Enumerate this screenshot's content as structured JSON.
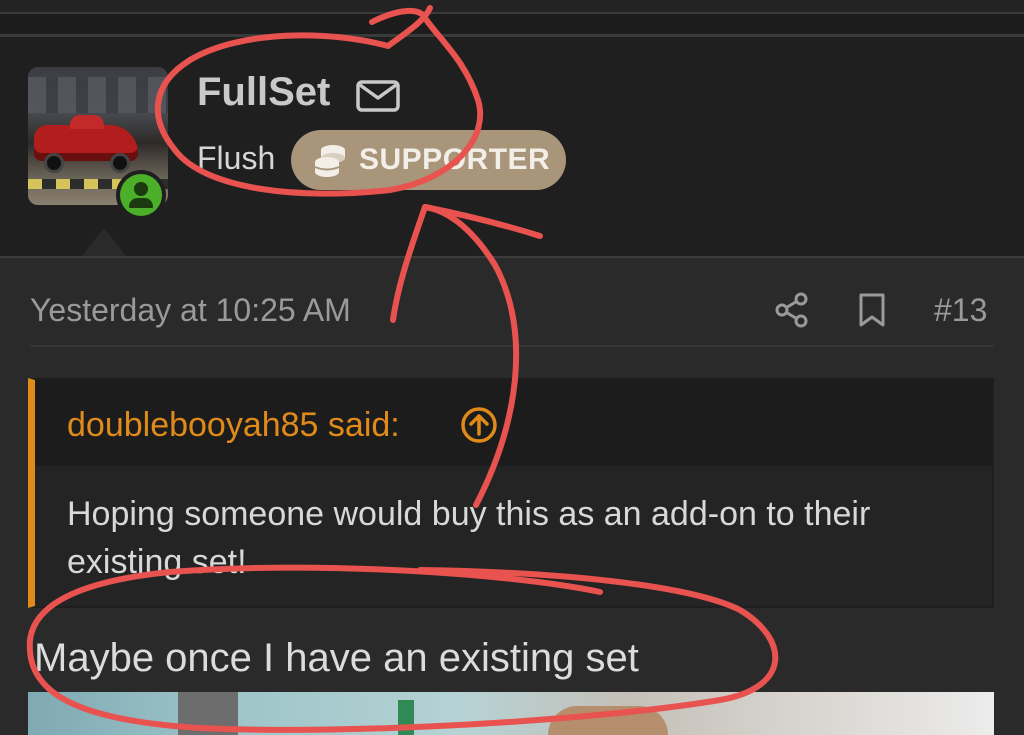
{
  "author": {
    "username": "FullSet",
    "user_title": "Flush",
    "badge_label": "SUPPORTER",
    "mail_icon": "envelope-icon",
    "online_icon": "online-user-icon"
  },
  "post": {
    "timestamp": "Yesterday at 10:25 AM",
    "post_number": "#13",
    "share_icon": "share-icon",
    "bookmark_icon": "bookmark-icon",
    "quote": {
      "author": "doublebooyah85 said:",
      "text": "Hoping someone would buy this as an add-on to their existing set!"
    },
    "reply_text": "Maybe once I have an existing set"
  },
  "colors": {
    "background": "#1c1c1c",
    "post_background": "#2a2a2a",
    "quote_accent": "#e08a1a",
    "badge": "#a8957a",
    "online": "#4caf2a",
    "annotation": "#e8524f"
  }
}
